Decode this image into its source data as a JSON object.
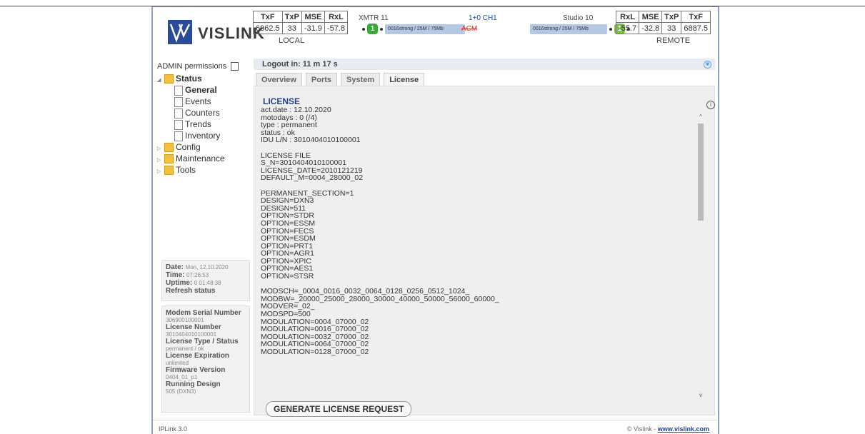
{
  "logo": {
    "brand": "VISLINK"
  },
  "header": {
    "local": {
      "headers": [
        "TxF",
        "TxP",
        "MSE",
        "RxL"
      ],
      "values": [
        "6962.5",
        "33",
        "-31.9",
        "-57.8"
      ],
      "label": "LOCAL"
    },
    "remote": {
      "headers": [
        "RxL",
        "MSE",
        "TxP",
        "TxF"
      ],
      "values": [
        "-55.7",
        "-32.8",
        "33",
        "6887.5"
      ],
      "label": "REMOTE"
    },
    "left_name": "XMTR 11",
    "center_name": "1+0 CH1",
    "right_name": "Studio 10",
    "left_badge": "1",
    "right_badge": "1",
    "left_mod": "0016strong / 25M / 75Mb",
    "right_mod": "0016strong / 25M / 75Mb",
    "acm": "ACM"
  },
  "sidebar": {
    "permissions": "ADMIN permissions",
    "tree": {
      "status": "Status",
      "general": "General",
      "events": "Events",
      "counters": "Counters",
      "trends": "Trends",
      "inventory": "Inventory",
      "config": "Config",
      "maintenance": "Maintenance",
      "tools": "Tools"
    },
    "date_label": "Date:",
    "date_value": "Mon, 12.10.2020",
    "time_label": "Time:",
    "time_value": "07:26:53",
    "uptime_label": "Uptime:",
    "uptime_value": "0 01:48:38",
    "refresh": "Refresh status",
    "modem_sn_label": "Modem Serial Number",
    "modem_sn": "306900100001",
    "license_no_label": "License Number",
    "license_no": "3010404010100001",
    "license_type_label": "License Type / Status",
    "license_type": "permanent / ok",
    "license_exp_label": "License Expiration",
    "license_exp": "unlimited",
    "fw_label": "Firmware Version",
    "fw": "0404_01_p1",
    "design_label": "Running Design",
    "design": "505 (DXN3)"
  },
  "main": {
    "logout": "Logout in: 11 m 17 s",
    "tabs": [
      "Overview",
      "Ports",
      "System",
      "License"
    ],
    "license_title": "LICENSE",
    "license_text": "act.date : 12.10.2020\nmotodays : 0 (/4)\ntype : permanent\nstatus : ok\nIDU L/N : 3010404010100001\n\nLICENSE FILE\nS_N=3010404010100001\nLICENSE_DATE=2010121219\nDEFAULT_M=0004_28000_02\n\nPERMANENT_SECTION=1\nDESIGN=DXN3\nDESIGN=511\nOPTION=STDR\nOPTION=ESSM\nOPTION=FECS\nOPTION=ESDM\nOPTION=PRT1\nOPTION=AGR1\nOPTION=XPIC\nOPTION=AES1\nOPTION=STSR\n\nMODSCH=_0004_0016_0032_0064_0128_0256_0512_1024_\nMODBW=_20000_25000_28000_30000_40000_50000_56000_60000_\nMODVER=_02_\nMODSPD=500\nMODULATION=0004_07000_02\nMODULATION=0016_07000_02\nMODULATION=0032_07000_02\nMODULATION=0064_07000_02\nMODULATION=0128_07000_02",
    "generate_button": "GENERATE LICENSE REQUEST"
  },
  "footer": {
    "left": "IPLink 3.0",
    "copyright": "© Vislink - ",
    "link": "www.vislink.com"
  }
}
